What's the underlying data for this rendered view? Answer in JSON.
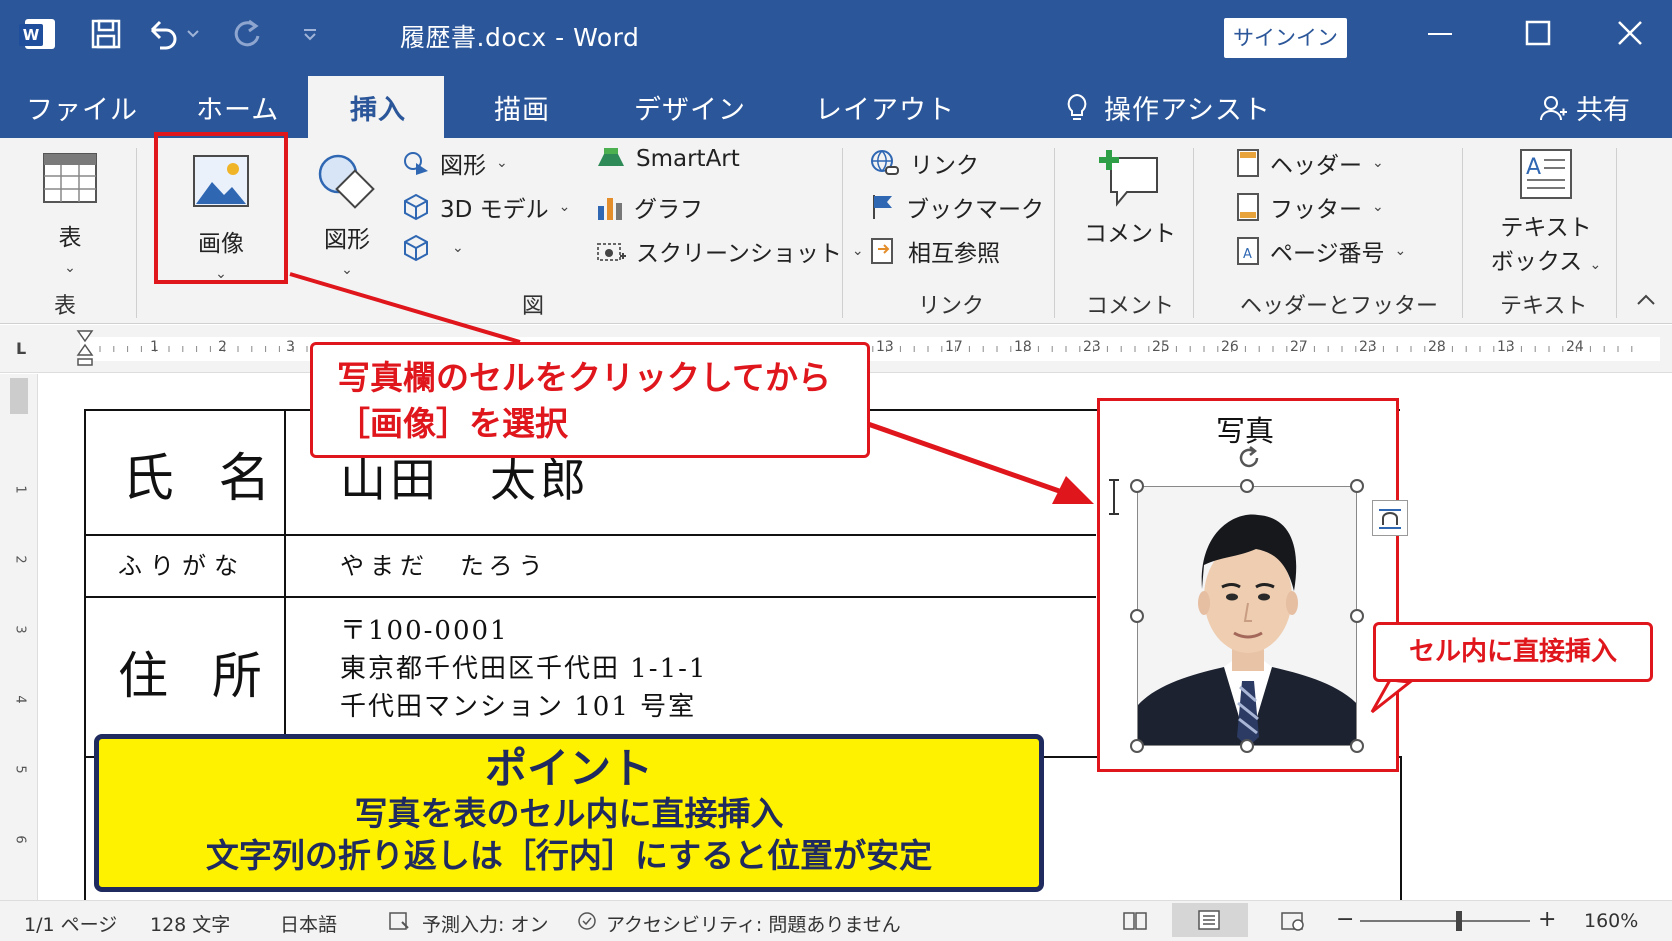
{
  "title_bar": {
    "doc_title": "履歴書.docx  -  Word",
    "signin": "サインイン",
    "icons": [
      "word-app-icon",
      "save-icon",
      "undo-icon",
      "redo-icon",
      "customize-icon",
      "minimize-icon",
      "maximize-icon",
      "close-icon"
    ]
  },
  "tabs": {
    "file": "ファイル",
    "home": "ホーム",
    "insert": "挿入",
    "draw": "描画",
    "design": "デザイン",
    "layout": "レイアウト",
    "assist": "操作アシスト",
    "share": "共有"
  },
  "ribbon": {
    "table_btn": "表",
    "table_group": "表",
    "image_btn": "画像",
    "shapes_btn": "図形",
    "shapes_small": "図形",
    "model3d": "3D モデル",
    "smartart": "SmartArt",
    "chart": "グラフ",
    "screenshot": "スクリーンショット",
    "fig_group": "図",
    "link": "リンク",
    "bookmark": "ブックマーク",
    "crossref": "相互参照",
    "link_group": "リンク",
    "comment_btn": "コメント",
    "comment_group": "コメント",
    "header": "ヘッダー",
    "footer": "フッター",
    "page_number": "ページ番号",
    "hf_group": "ヘッダーとフッター",
    "textbox_l1": "テキスト",
    "textbox_l2": "ボックス",
    "text_group": "テキスト"
  },
  "ruler": {
    "marks_left": [
      "1",
      "2",
      "3"
    ],
    "marks_right": [
      "13",
      "17",
      "18",
      "23",
      "25",
      "26",
      "27",
      "23",
      "28",
      "13",
      "24"
    ],
    "vmarks": [
      "1",
      "2",
      "3",
      "4",
      "5",
      "6"
    ]
  },
  "resume": {
    "name_label": "氏 名",
    "name_value": "山田　太郎",
    "furigana_label": "ふりがな",
    "furigana_value": "やまだ　たろう",
    "address_label": "住 所",
    "address_lines": [
      "〒100-0001",
      "東京都千代田区千代田 1-1-1",
      "千代田マンション 101 号室"
    ],
    "photo_caption": "写真"
  },
  "callouts": {
    "main_l1": "写真欄のセルをクリックしてから",
    "main_l2": "［画像］を選択",
    "side": "セル内に直接挿入"
  },
  "point": {
    "title": "ポイント",
    "line1": "写真を表のセル内に直接挿入",
    "line2": "文字列の折り返しは［行内］にすると位置が安定"
  },
  "status": {
    "page": "1/1 ページ",
    "words": "128 文字",
    "lang": "日本語",
    "predict": "予測入力: オン",
    "access": "アクセシビリティ: 問題ありません",
    "zoom": "160%"
  },
  "colors": {
    "titlebar": "#2b5699",
    "ribbon": "#f3f3f3",
    "accent_red": "#e0161d",
    "point_yellow": "#fff200",
    "point_navy": "#1f2a5e"
  }
}
